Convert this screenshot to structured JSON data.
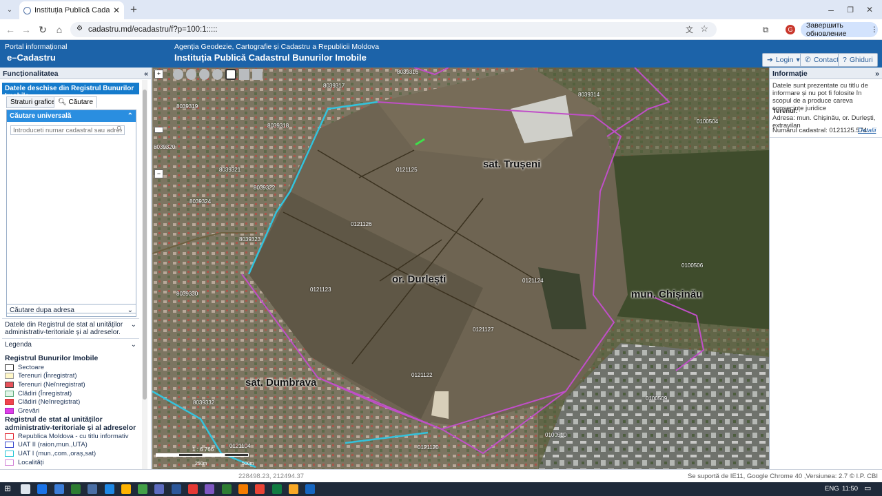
{
  "browser": {
    "tab_title": "Instituția Publică Cadastrul Buni",
    "url": "cadastru.md/ecadastru/f?p=100:1:::::",
    "update_label": "Завершить обновление",
    "profile_initial": "G"
  },
  "header": {
    "portal_line": "Portal informațional",
    "portal_name": "e–Cadastru",
    "agency": "Agenția Geodezie, Cartografie și Cadastru a Republicii Moldova",
    "institution": "Instituția Publică Cadastrul Bunurilor Imobile",
    "login_label": "Login",
    "contact_label": "Contacte",
    "guides_label": "Ghiduri"
  },
  "left_panel": {
    "title": "Funcționalitatea",
    "selected_item": "Datele deschise din Registrul Bunurilor Imobile",
    "tab_layers": "Straturi grafice",
    "tab_search": "Căutare",
    "search_section_title": "Căutare universală",
    "search_placeholder": "Introduceti numar cadastral sau adresa ...",
    "search_by_address": "Căutare dupa adresa",
    "state_register": "Datele din Registrul de stat al unităților administrativ-teritoriale și al adreselor.",
    "legend_title": "Legenda",
    "legend_group1": "Registrul Bunurilor Imobile",
    "legend1": [
      {
        "label": "Sectoare",
        "color": "#ffffff",
        "border": "#222222"
      },
      {
        "label": "Terenuri (Înregistrat)",
        "color": "#fff7c8",
        "border": "#999999"
      },
      {
        "label": "Terenuri (Neînregistrat)",
        "color": "#e8525a",
        "border": "#444444"
      },
      {
        "label": "Clădiri (Înregistrat)",
        "color": "#e0f5e6",
        "border": "#5aa87a"
      },
      {
        "label": "Clădiri (Neînregistrat)",
        "color": "#f0434f",
        "border": "#cc3333"
      },
      {
        "label": "Grevări",
        "color": "#dd3fe8",
        "border": "#aa22bb"
      }
    ],
    "legend_group2": "Registrul de stat al unităților administrativ-teritoriale și al adreselor",
    "legend2": [
      {
        "label": "Republica Moldova - cu titlu informativ",
        "color": "#ffffff",
        "border": "#e0202a"
      },
      {
        "label": "UAT II (raion,mun.,UTA)",
        "color": "#ffffff",
        "border": "#3344cc"
      },
      {
        "label": "UAT I (mun.,com.,oraș,sat)",
        "color": "#ffffff",
        "border": "#22c4d4"
      },
      {
        "label": "Localități",
        "color": "#ffffff",
        "border": "#d080d6"
      }
    ]
  },
  "right_panel": {
    "title": "Informație",
    "notice": "Datele sunt prezentate cu titlu de informare și nu pot fi folosite în scopul de a produce careva consecințe juridice",
    "land_heading": "Terenul:",
    "address": "Adresa: mun. Chișinău, or. Durlești, extravilan",
    "cadastral": "Numărul cadastral: 0121125.574",
    "details_link": "Detalii"
  },
  "map": {
    "scale": "1 : 6 766",
    "scale_250": "250m",
    "scale_500": "500m",
    "places": [
      "sat. Trușeni",
      "or. Durlești",
      "mun. Chișinău",
      "sat. Dumbrava"
    ],
    "parcels": [
      "8039316",
      "8039317",
      "8039314",
      "0100504",
      "8039318",
      "8039319",
      "8039320",
      "8039321",
      "8039322",
      "8039324",
      "0121125",
      "0121126",
      "8039323",
      "0100506",
      "0121123",
      "0121124",
      "8039330",
      "0121127",
      "0121122",
      "8039332",
      "0100509",
      "0121104",
      "0121120",
      "0100510"
    ]
  },
  "status": {
    "coords": "228498.23, 212494.37",
    "support": "Se suportă de IE11, Google Chrome 40 ,Versiunea: 2.7 © I.P. CBI"
  },
  "taskbar": {
    "lang": "ENG",
    "time": "11:50"
  }
}
